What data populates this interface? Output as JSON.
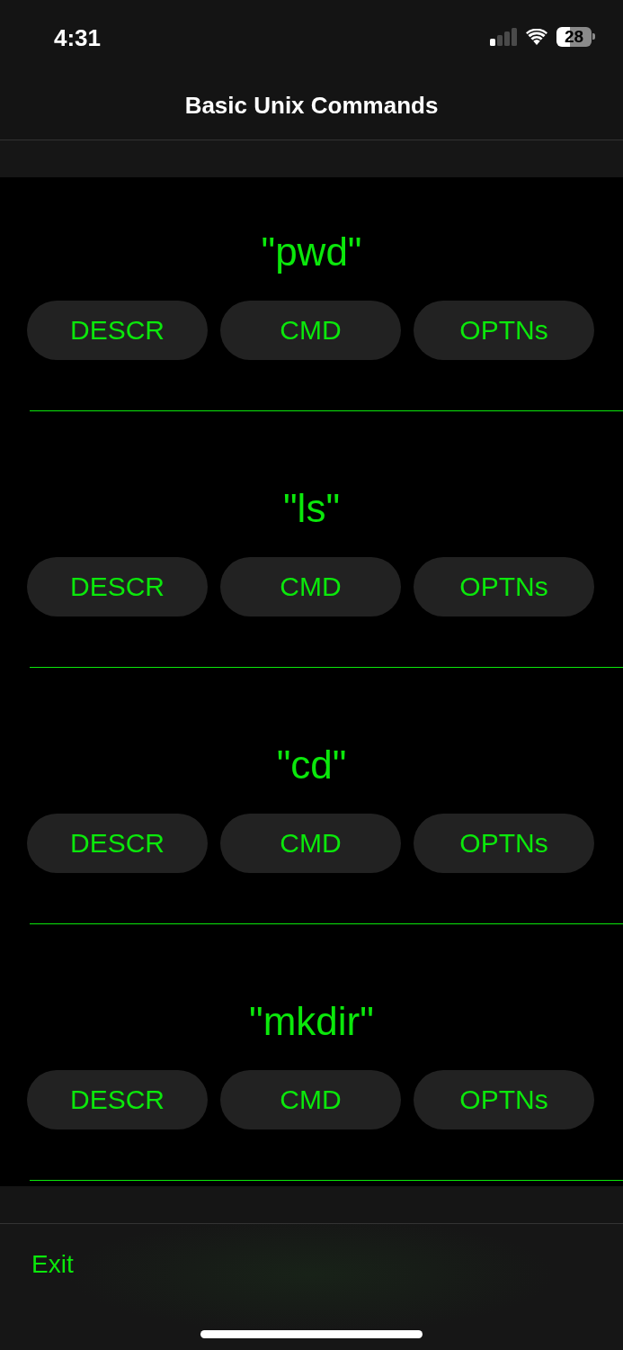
{
  "status_bar": {
    "time": "4:31",
    "battery": "28"
  },
  "nav_bar": {
    "title": "Basic Unix Commands"
  },
  "commands": [
    {
      "name": "\"pwd\"",
      "buttons": [
        "DESCR",
        "CMD",
        "OPTNs"
      ]
    },
    {
      "name": "\"ls\"",
      "buttons": [
        "DESCR",
        "CMD",
        "OPTNs"
      ]
    },
    {
      "name": "\"cd\"",
      "buttons": [
        "DESCR",
        "CMD",
        "OPTNs"
      ]
    },
    {
      "name": "\"mkdir\"",
      "buttons": [
        "DESCR",
        "CMD",
        "OPTNs"
      ]
    }
  ],
  "toolbar": {
    "exit": "Exit"
  }
}
